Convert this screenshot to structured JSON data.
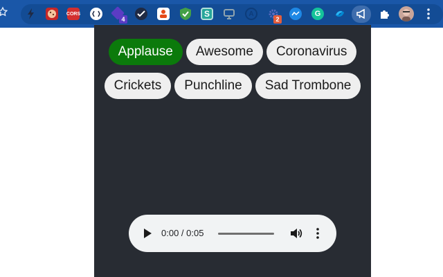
{
  "toolbar": {
    "extensions": [
      {
        "name": "lightning-extension-icon",
        "color": "#1f2a44"
      },
      {
        "name": "cookie-extension-icon",
        "color": "#c62828"
      },
      {
        "name": "cors-extension-icon",
        "color": "#d32f2f",
        "label": "CORS"
      },
      {
        "name": "brackets-extension-icon",
        "color": "#ffffff"
      },
      {
        "name": "cube-extension-icon",
        "color": "#5b3cc4",
        "badge": "4"
      },
      {
        "name": "check-extension-icon",
        "color": "#1f2a44"
      },
      {
        "name": "people-extension-icon",
        "color": "#e64a19"
      },
      {
        "name": "shield-check-extension-icon",
        "color": "#43a047"
      },
      {
        "name": "s-extension-icon",
        "color": "#26a69a",
        "label": "S"
      },
      {
        "name": "monitor-extension-icon",
        "color": "#90a4ae"
      },
      {
        "name": "a-circle-extension-icon",
        "color": "#0d3c7a",
        "label": "A"
      },
      {
        "name": "gear-extension-icon",
        "color": "#5c6bc0",
        "badge": "2"
      },
      {
        "name": "messenger-extension-icon",
        "color": "#1e88e5"
      },
      {
        "name": "grammarly-extension-icon",
        "color": "#15c39a",
        "label": "G"
      },
      {
        "name": "swirl-extension-icon",
        "color": "#29b6f6"
      },
      {
        "name": "megaphone-extension-icon",
        "color": "#ffffff"
      },
      {
        "name": "puzzle-extension-icon",
        "color": "#ffffff"
      }
    ]
  },
  "sounds": [
    {
      "label": "Applause",
      "active": true
    },
    {
      "label": "Awesome",
      "active": false
    },
    {
      "label": "Coronavirus",
      "active": false
    },
    {
      "label": "Crickets",
      "active": false
    },
    {
      "label": "Punchline",
      "active": false
    },
    {
      "label": "Sad Trombone",
      "active": false
    }
  ],
  "audio": {
    "time": "0:00 / 0:05",
    "progress": 0
  }
}
